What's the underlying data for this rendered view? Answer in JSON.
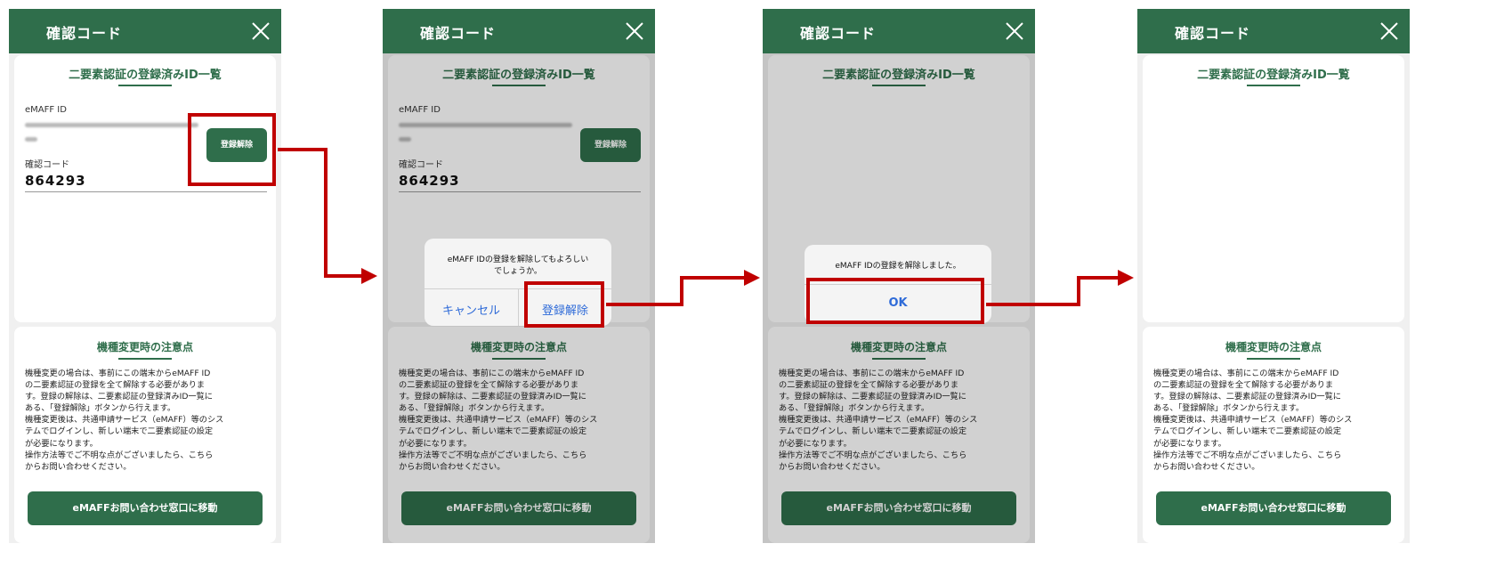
{
  "header": {
    "title": "確認コード"
  },
  "registered": {
    "title": "二要素認証の登録済みID一覧",
    "id_label": "eMAFF ID",
    "code_label": "確認コード",
    "code_value": "864293",
    "unregister_label": "登録解除"
  },
  "notice": {
    "title": "機種変更時の注意点",
    "lines": [
      "機種変更の場合は、事前にこの端末からeMAFF ID",
      "の二要素認証の登録を全て解除する必要がありま",
      "す。登録の解除は、二要素認証の登録済みID一覧に",
      "ある、「登録解除」ボタンから行えます。",
      "機種変更後は、共通申請サービス（eMAFF）等のシス",
      "テムでログインし、新しい端末で二要素認証の設定",
      "が必要になります。",
      "操作方法等でご不明な点がございましたら、こちら",
      "からお問い合わせください。"
    ],
    "button_label": "eMAFFお問い合わせ窓口に移動"
  },
  "confirm_dialog": {
    "message_line1": "eMAFF IDの登録を解除してもよろしい",
    "message_line2": "でしょうか。",
    "cancel_label": "キャンセル",
    "confirm_label": "登録解除"
  },
  "done_dialog": {
    "message": "eMAFF IDの登録を解除しました。",
    "ok_label": "OK"
  },
  "colors": {
    "brand_green": "#2f6e4b",
    "highlight_red": "#c00000",
    "ios_blue": "#2f6bd8"
  },
  "icons": {
    "close": "close-icon"
  }
}
